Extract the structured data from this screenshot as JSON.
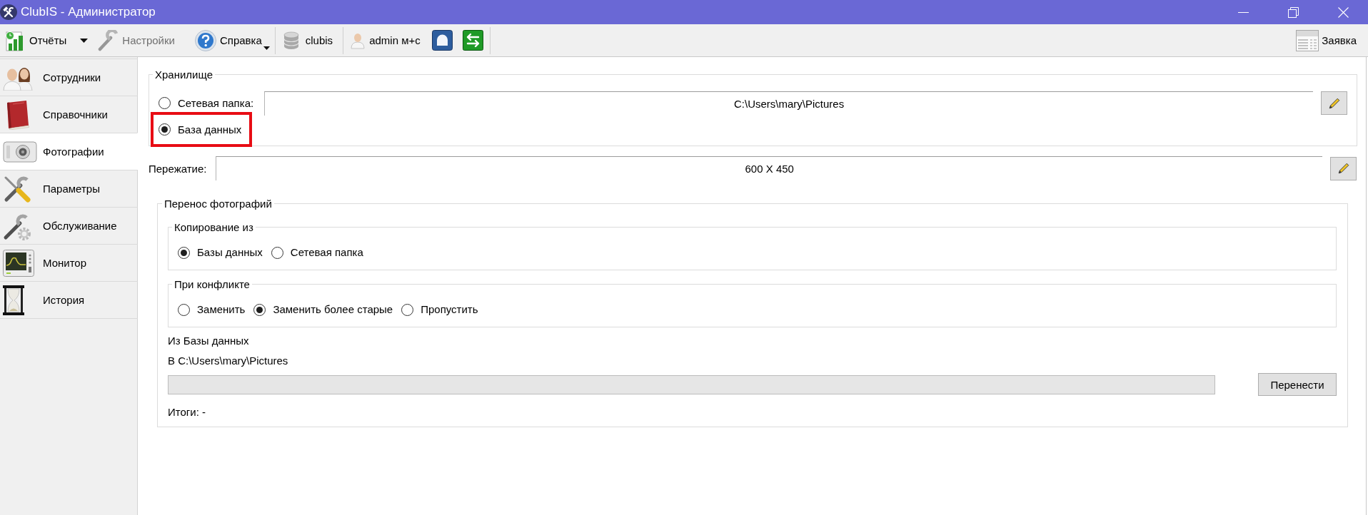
{
  "window": {
    "title": "ClubIS - Администратор"
  },
  "toolbar": {
    "reports": {
      "label": "Отчёты",
      "disabled": false
    },
    "settings": {
      "label": "Настройки",
      "disabled": true
    },
    "help": {
      "label": "Справка",
      "disabled": false
    },
    "database": {
      "label": "clubis"
    },
    "user": {
      "label": "admin м+с"
    },
    "request": {
      "label": "Заявка"
    }
  },
  "sidebar": {
    "items": [
      {
        "label": "Сотрудники",
        "selected": false
      },
      {
        "label": "Справочники",
        "selected": false
      },
      {
        "label": "Фотографии",
        "selected": true
      },
      {
        "label": "Параметры",
        "selected": false
      },
      {
        "label": "Обслуживание",
        "selected": false
      },
      {
        "label": "Монитор",
        "selected": false
      },
      {
        "label": "История",
        "selected": false
      }
    ]
  },
  "storage": {
    "title": "Хранилище",
    "options": [
      {
        "kind": "path",
        "label": "Сетевая папка:",
        "selected": false,
        "highlighted": false,
        "value": "C:\\Users\\mary\\Pictures"
      },
      {
        "kind": "plain",
        "label": "База данных",
        "selected": true,
        "highlighted": true
      }
    ]
  },
  "compression": {
    "label": "Пережатие:",
    "value": "600 X 450"
  },
  "transfer": {
    "title": "Перенос фотографий",
    "copy_from": {
      "title": "Копирование из",
      "options": [
        {
          "label": "Базы данных",
          "selected": true
        },
        {
          "label": "Сетевая папка",
          "selected": false
        }
      ]
    },
    "on_conflict": {
      "title": "При конфликте",
      "options": [
        {
          "label": "Заменить",
          "selected": false
        },
        {
          "label": "Заменить более старые",
          "selected": true
        },
        {
          "label": "Пропустить",
          "selected": false
        }
      ]
    },
    "source": "Из Базы данных",
    "destination": "В C:\\Users\\mary\\Pictures",
    "progress": {
      "level": 0
    },
    "button": "Перенести",
    "summary": "Итоги: -"
  }
}
